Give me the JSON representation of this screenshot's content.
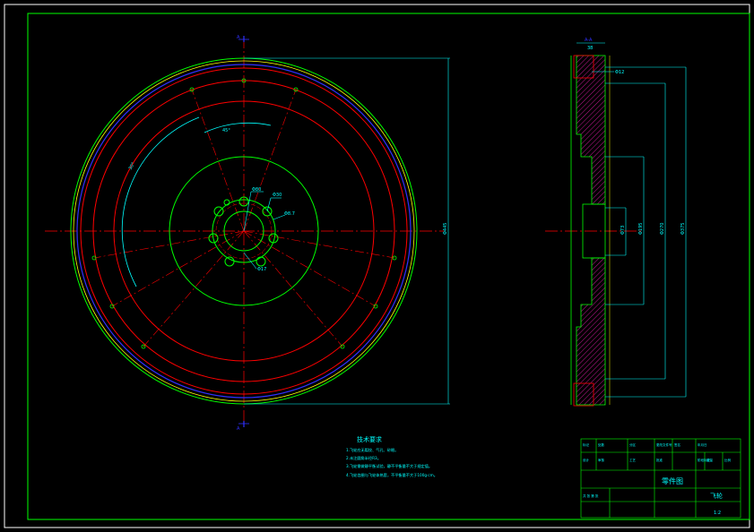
{
  "colors": {
    "background": "#000000",
    "frame": "#ffffff",
    "border": "#00ff00",
    "centerline": "#ff0000",
    "cyan": "#00ffff",
    "blue": "#3030ff",
    "magenta": "#ff00ff",
    "hatch": "#c01890",
    "yellow": "#ffff00"
  },
  "front_view": {
    "section_mark_top": "A",
    "section_mark_bottom": "A",
    "dim_angle_a": "45°",
    "dim_angle_b": "30°",
    "dim_hole_pcd": "Φ80",
    "dim_hole_a": "Φ30",
    "dim_hole_b": "Φ8.7",
    "dim_hole_c": "Φ17",
    "dim_outer": "Φ445"
  },
  "side_view": {
    "section_label": "A-A",
    "dim_width": "38",
    "dim_top_hole": "Φ12",
    "dim_d1": "Φ73",
    "dim_d2": "Φ195",
    "dim_d3": "Φ270",
    "dim_d4": "Φ375"
  },
  "notes": {
    "title": "技术要求",
    "lines": [
      "1.飞轮应无裂纹、气孔、砂眼。",
      "2.未注圆角半径R3。",
      "3.飞轮需做静平衡试验，静不平衡量不大于规定值。",
      "4.飞轮齿圈与飞轮体热套，不平衡量不大于100g·cm。"
    ]
  },
  "title_block": {
    "drawing_title": "零件图",
    "part_name": "飞轮",
    "sheet_no": "1:2",
    "small_cells": [
      "标记",
      "处数",
      "分区",
      "更改文件号",
      "签名",
      "年月日",
      "设计",
      "审核",
      "工艺",
      "批准",
      "阶段标记",
      "重量",
      "比例",
      "共 张 第 张"
    ]
  }
}
